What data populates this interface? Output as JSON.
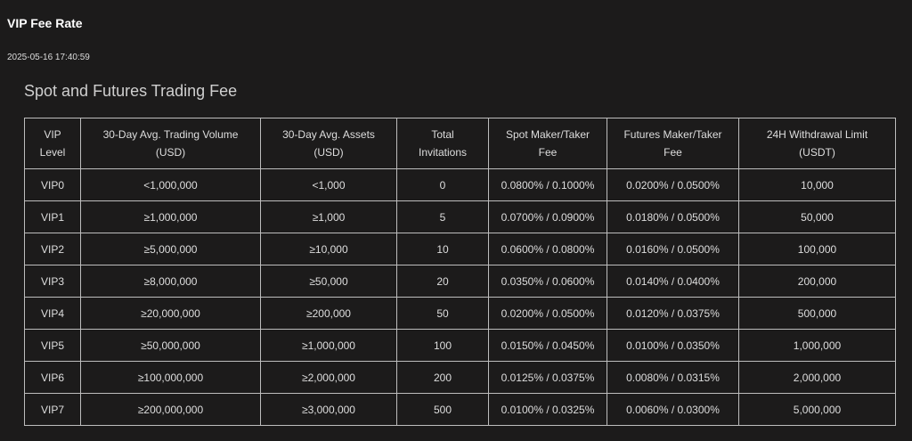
{
  "header": {
    "title": "VIP Fee Rate",
    "timestamp": "2025-05-16 17:40:59"
  },
  "section": {
    "title": "Spot and Futures Trading Fee"
  },
  "table": {
    "columns": [
      [
        "VIP",
        "Level"
      ],
      [
        "30-Day Avg. Trading Volume",
        "(USD)"
      ],
      [
        "30-Day Avg. Assets",
        "(USD)"
      ],
      [
        "Total",
        "Invitations"
      ],
      [
        "Spot Maker/Taker",
        "Fee"
      ],
      [
        "Futures Maker/Taker",
        "Fee"
      ],
      [
        "24H Withdrawal Limit",
        "(USDT)"
      ]
    ],
    "rows": [
      [
        "VIP0",
        "<1,000,000",
        "<1,000",
        "0",
        "0.0800% / 0.1000%",
        "0.0200% / 0.0500%",
        "10,000"
      ],
      [
        "VIP1",
        "≥1,000,000",
        "≥1,000",
        "5",
        "0.0700% / 0.0900%",
        "0.0180% / 0.0500%",
        "50,000"
      ],
      [
        "VIP2",
        "≥5,000,000",
        "≥10,000",
        "10",
        "0.0600% / 0.0800%",
        "0.0160% / 0.0500%",
        "100,000"
      ],
      [
        "VIP3",
        "≥8,000,000",
        "≥50,000",
        "20",
        "0.0350% / 0.0600%",
        "0.0140% / 0.0400%",
        "200,000"
      ],
      [
        "VIP4",
        "≥20,000,000",
        "≥200,000",
        "50",
        "0.0200% / 0.0500%",
        "0.0120% / 0.0375%",
        "500,000"
      ],
      [
        "VIP5",
        "≥50,000,000",
        "≥1,000,000",
        "100",
        "0.0150% / 0.0450%",
        "0.0100% / 0.0350%",
        "1,000,000"
      ],
      [
        "VIP6",
        "≥100,000,000",
        "≥2,000,000",
        "200",
        "0.0125% / 0.0375%",
        "0.0080% / 0.0315%",
        "2,000,000"
      ],
      [
        "VIP7",
        "≥200,000,000",
        "≥3,000,000",
        "500",
        "0.0100% / 0.0325%",
        "0.0060% / 0.0300%",
        "5,000,000"
      ]
    ]
  }
}
